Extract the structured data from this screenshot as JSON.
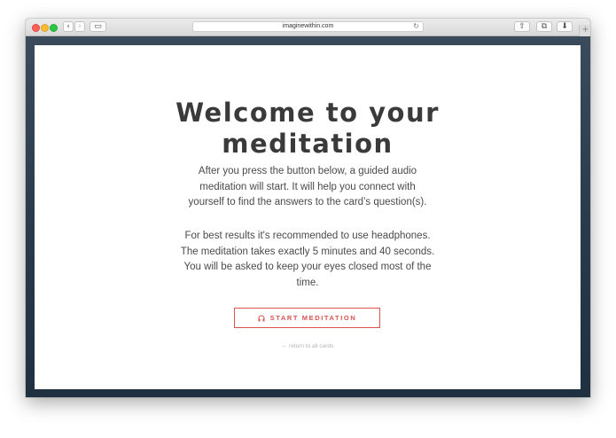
{
  "browser": {
    "url": "imaginewithin.com",
    "back_icon": "‹",
    "forward_icon": "›",
    "sidebar_icon": "▭",
    "reload_icon": "↻",
    "share_icon": "⇧",
    "tabs_icon": "⧉",
    "download_icon": "⬇",
    "new_tab_icon": "+"
  },
  "page": {
    "title_line1": "Welcome to your",
    "title_line2": "meditation",
    "paragraph1": [
      "After you press the button below, a guided audio",
      "meditation will start. It will help you connect with",
      "yourself to find the answers to the card’s question(s)."
    ],
    "paragraph2": [
      "For best results it's recommended to use headphones.",
      "The meditation takes exactly 5 minutes and 40 seconds.",
      "You will be asked to keep your eyes closed most of the",
      "time."
    ],
    "start_button": "START MEDITATION",
    "back_link": "← return to all cards"
  },
  "colors": {
    "accent": "#d9534f",
    "title": "#3a3a3a",
    "text": "#4a4a4a",
    "muted_link": "#b3b3b3"
  }
}
